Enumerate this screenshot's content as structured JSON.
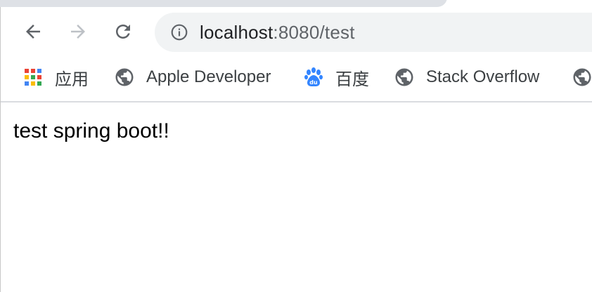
{
  "toolbar": {
    "back_icon": "arrow-left-icon",
    "forward_icon": "arrow-right-icon",
    "reload_icon": "reload-icon",
    "info_icon": "info-icon",
    "url_host": "localhost",
    "url_rest": ":8080/test"
  },
  "bookmarks": {
    "items": [
      {
        "label": "应用",
        "icon": "apps-grid-icon"
      },
      {
        "label": "Apple Developer",
        "icon": "globe-icon"
      },
      {
        "label": "百度",
        "icon": "baidu-paw-icon"
      },
      {
        "label": "Stack Overflow",
        "icon": "globe-icon"
      },
      {
        "label": "",
        "icon": "globe-icon"
      }
    ]
  },
  "page": {
    "text": "test spring boot!!"
  },
  "colors": {
    "omnibox_bg": "#f1f3f4",
    "tab_bg": "#dee1e6",
    "icon_gray": "#5f6368",
    "disabled_gray": "#9aa0a6",
    "baidu_blue": "#3385ff"
  }
}
